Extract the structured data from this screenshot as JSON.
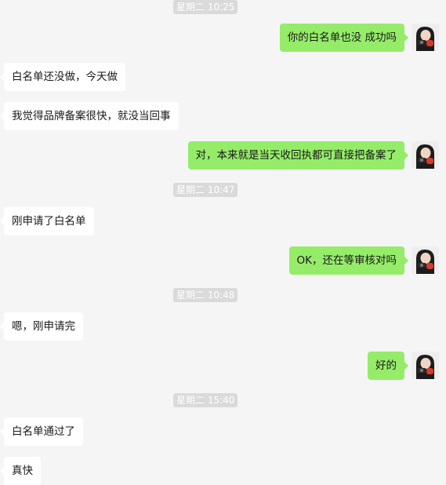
{
  "colors": {
    "background": "#f5f5f5",
    "incoming_bubble": "#ffffff",
    "outgoing_bubble": "#95ec69",
    "timestamp_bg": "#dadada",
    "timestamp_text": "#ffffff"
  },
  "messages": [
    {
      "kind": "timestamp",
      "text": "星期二 10:25"
    },
    {
      "kind": "sent",
      "text": "你的白名单也没 成功吗",
      "avatar": "user-photo-avatar"
    },
    {
      "kind": "received",
      "text": "白名单还没做，今天做"
    },
    {
      "kind": "received",
      "text": "我觉得品牌备案很快，就没当回事"
    },
    {
      "kind": "sent",
      "text": "对，本来就是当天收回执都可直接把备案了",
      "avatar": "user-photo-avatar"
    },
    {
      "kind": "timestamp",
      "text": "星期二 10:47"
    },
    {
      "kind": "received",
      "text": "刚申请了白名单"
    },
    {
      "kind": "sent",
      "text": "OK，还在等审核对吗",
      "avatar": "user-photo-avatar"
    },
    {
      "kind": "timestamp",
      "text": "星期二 10:48"
    },
    {
      "kind": "received",
      "text": "嗯，刚申请完"
    },
    {
      "kind": "sent",
      "text": "好的",
      "avatar": "user-photo-avatar"
    },
    {
      "kind": "timestamp",
      "text": "星期二 15:40"
    },
    {
      "kind": "received",
      "text": "白名单通过了"
    },
    {
      "kind": "received",
      "text": "真快"
    }
  ]
}
